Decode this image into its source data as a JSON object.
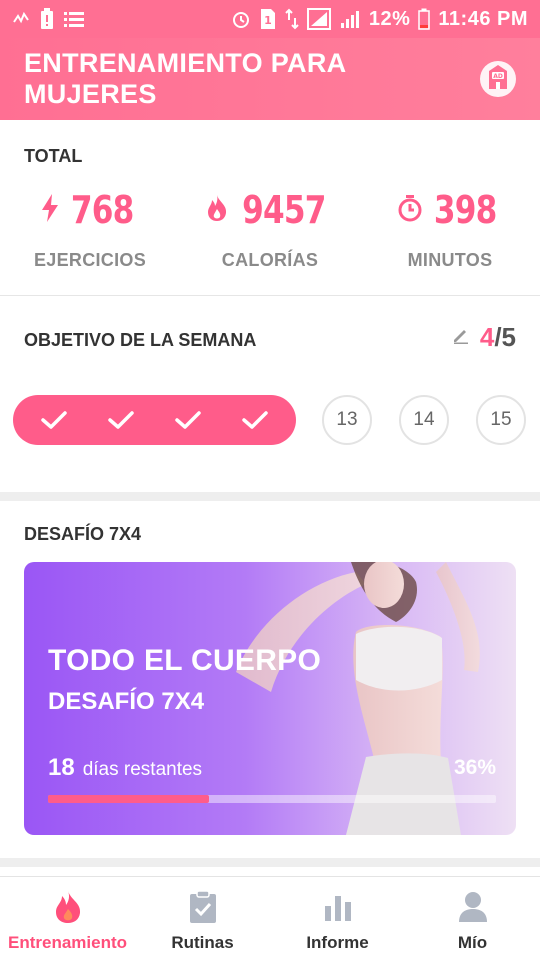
{
  "status_bar": {
    "icons": [
      "activity-icon",
      "battery-alert-icon",
      "list-icon",
      "alarm-icon",
      "sim-icon",
      "data-arrows-icon",
      "signal-icon",
      "signal-icon"
    ],
    "battery": "12%",
    "time": "11:46 PM"
  },
  "app_bar": {
    "title": "ENTRENAMIENTO PARA MUJERES",
    "ad_icon": "ad-house-icon",
    "ad_text": "AD"
  },
  "totals": {
    "label": "TOTAL",
    "stats": [
      {
        "icon": "lightning-icon",
        "value": "768",
        "label": "EJERCICIOS"
      },
      {
        "icon": "flame-icon",
        "value": "9457",
        "label": "CALORÍAS"
      },
      {
        "icon": "stopwatch-icon",
        "value": "398",
        "label": "MINUTOS"
      }
    ]
  },
  "weekly_goal": {
    "label": "OBJETIVO DE LA SEMANA",
    "edit_icon": "pencil-icon",
    "done": "4",
    "total": "/5",
    "completed_days": 4,
    "upcoming_days": [
      "13",
      "14",
      "15"
    ]
  },
  "challenge": {
    "section_label": "DESAFÍO 7X4",
    "card_title": "TODO EL CUERPO",
    "card_subtitle": "DESAFÍO 7X4",
    "days_left_num": "18",
    "days_left_text": "días restantes",
    "percent": "36%",
    "progress": 0.36
  },
  "bottom_nav": [
    {
      "icon": "flame-icon",
      "label": "Entrenamiento",
      "active": true
    },
    {
      "icon": "clipboard-icon",
      "label": "Rutinas",
      "active": false
    },
    {
      "icon": "bar-chart-icon",
      "label": "Informe",
      "active": false
    },
    {
      "icon": "person-icon",
      "label": "Mío",
      "active": false
    }
  ],
  "colors": {
    "accent": "#ff5c8a",
    "header": "#ff6f93",
    "card_gradient_start": "#9a56f5",
    "card_gradient_end": "#eee0f4"
  }
}
